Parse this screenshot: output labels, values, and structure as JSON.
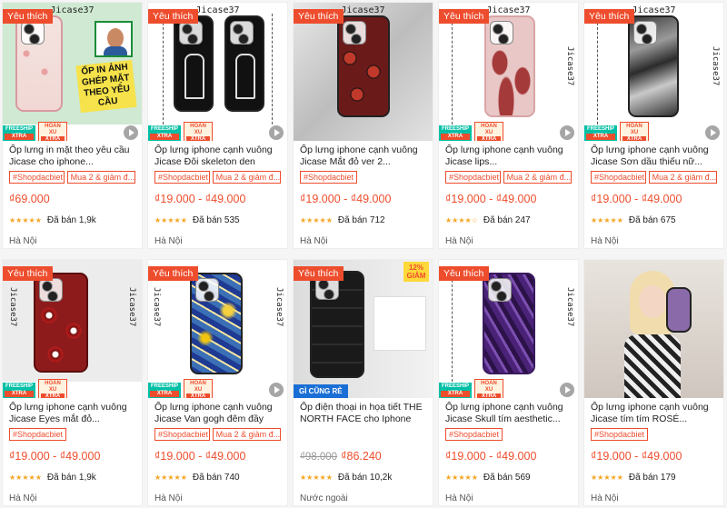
{
  "labels": {
    "favorite": "Yêu thích",
    "freeship": "FREESHIP",
    "xtra": "XTRA",
    "hoan_xu": "HOÀN XU",
    "brand": "Jicase37",
    "discount": "12% GIẢM",
    "gi_cung_re": "GÌ CŨNG RẺ",
    "overlay_1": "ỐP IN ẢNH GHÉP MẶT THEO YÊU CẦU"
  },
  "products": [
    {
      "title": "Ốp lưng in mặt theo yêu cầu Jicase cho iphone...",
      "tags": [
        "#Shopdacbiet",
        "Mua 2 & giảm đ..."
      ],
      "price": "₫69.000",
      "old_price": "",
      "sold": "Đã bán 1,9k",
      "location": "Hà Nội",
      "rating": 5
    },
    {
      "title": "Ốp lưng iphone cạnh vuông Jicase Đôi skeleton den trắn...",
      "tags": [
        "#Shopdacbiet",
        "Mua 2 & giảm đ..."
      ],
      "price": "₫19.000 - ₫49.000",
      "old_price": "",
      "sold": "Đã bán 535",
      "location": "Hà Nội",
      "rating": 5
    },
    {
      "title": "Ốp lưng iphone cạnh vuông Jicase Mắt đỏ ver 2...",
      "tags": [
        "#Shopdacbiet"
      ],
      "price": "₫19.000 - ₫49.000",
      "old_price": "",
      "sold": "Đã bán 712",
      "location": "Hà Nội",
      "rating": 5
    },
    {
      "title": "Ốp lưng iphone cạnh vuông Jicase lips...",
      "tags": [
        "#Shopdacbiet",
        "Mua 2 & giảm đ..."
      ],
      "price": "₫19.000 - ₫49.000",
      "old_price": "",
      "sold": "Đã bán 247",
      "location": "Hà Nội",
      "rating": 4.5
    },
    {
      "title": "Ốp lưng iphone cạnh vuông Jicase Sơn dầu thiếu nữ...",
      "tags": [
        "#Shopdacbiet",
        "Mua 2 & giảm đ..."
      ],
      "price": "₫19.000 - ₫49.000",
      "old_price": "",
      "sold": "Đã bán 675",
      "location": "Hà Nội",
      "rating": 5
    },
    {
      "title": "Ốp lưng iphone cạnh vuông Jicase Eyes mắt đỏ...",
      "tags": [
        "#Shopdacbiet"
      ],
      "price": "₫19.000 - ₫49.000",
      "old_price": "",
      "sold": "Đã bán 1,9k",
      "location": "Hà Nội",
      "rating": 5
    },
    {
      "title": "Ốp lưng iphone cạnh vuông Jicase Van gogh đêm đầy sa...",
      "tags": [
        "#Shopdacbiet",
        "Mua 2 & giảm đ..."
      ],
      "price": "₫19.000 - ₫49.000",
      "old_price": "",
      "sold": "Đã bán 740",
      "location": "Hà Nội",
      "rating": 5
    },
    {
      "title": "Ốp điện thoại in họa tiết THE NORTH FACE cho Iphone 13...",
      "tags": [],
      "price": "₫86.240",
      "old_price": "₫98.000",
      "sold": "Đã bán 10,2k",
      "location": "Nước ngoài",
      "rating": 5
    },
    {
      "title": "Ốp lưng iphone cạnh vuông Jicase Skull tím aesthetic...",
      "tags": [
        "#Shopdacbiet"
      ],
      "price": "₫19.000 - ₫49.000",
      "old_price": "",
      "sold": "Đã bán 569",
      "location": "Hà Nội",
      "rating": 5
    },
    {
      "title": "Ốp lưng iphone cạnh vuông Jicase tím tím ROSÉ...",
      "tags": [
        "#Shopdacbiet"
      ],
      "price": "₫19.000 - ₫49.000",
      "old_price": "",
      "sold": "Đã bán 179",
      "location": "Hà Nội",
      "rating": 5
    }
  ],
  "colors": {
    "accent": "#ee4d2d",
    "star": "#f5a623",
    "freeship": "#00bfa5"
  }
}
